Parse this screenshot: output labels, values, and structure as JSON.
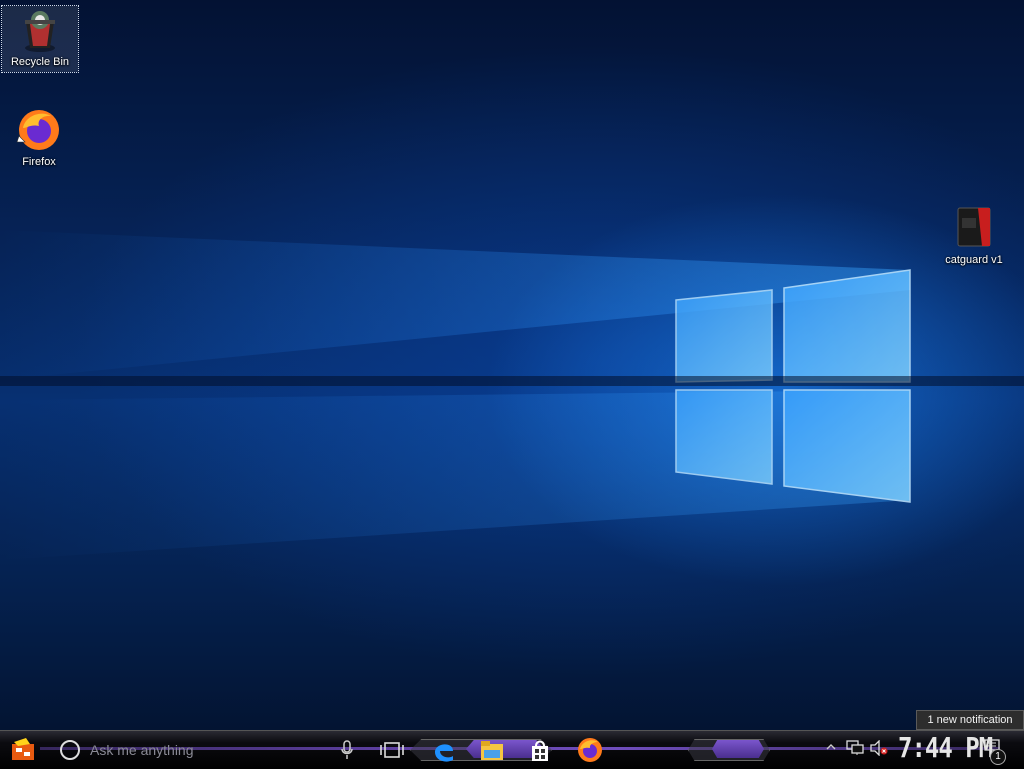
{
  "desktop": {
    "icons": [
      {
        "label": "Recycle Bin",
        "icon": "recycle-bin-icon",
        "selected": true
      },
      {
        "label": "Firefox",
        "icon": "firefox-icon",
        "shortcut": true
      },
      {
        "label": "catguard v1",
        "icon": "catguard-icon"
      }
    ]
  },
  "taskbar": {
    "start_icon": "start-icon",
    "search": {
      "placeholder": "Ask me anything",
      "icon": "cortana-circle-icon"
    },
    "mic_icon": "microphone-icon",
    "pinned": [
      {
        "name": "task-view",
        "icon": "task-view-icon"
      },
      {
        "name": "edge",
        "icon": "edge-icon"
      },
      {
        "name": "file-explorer",
        "icon": "folder-icon",
        "active": true
      },
      {
        "name": "store",
        "icon": "store-icon"
      },
      {
        "name": "firefox",
        "icon": "firefox-icon"
      }
    ],
    "tray": {
      "chevron_icon": "chevron-up-icon",
      "network_icon": "network-icon",
      "volume_icon": "volume-muted-icon",
      "time": "7:44 PM",
      "action_center_icon": "notification-icon",
      "notification_count": "1",
      "notification_tooltip": "1 new notification"
    }
  },
  "colors": {
    "accent": "#7b55d0",
    "wallpaper_light": "#1e8cff",
    "wallpaper_dark": "#031233"
  }
}
